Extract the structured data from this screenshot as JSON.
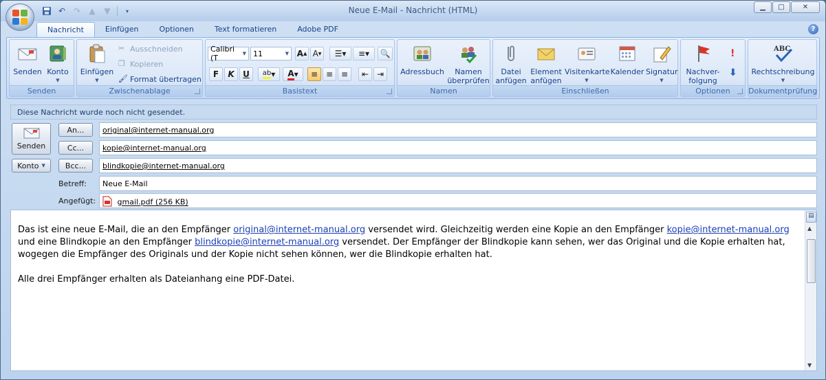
{
  "window": {
    "title": "Neue E-Mail - Nachricht (HTML)",
    "controls": {
      "minimize": "▁",
      "maximize": "□",
      "close": "✕"
    }
  },
  "qat": {
    "icons": [
      "save-icon",
      "undo-icon",
      "redo-icon",
      "up-arrow-icon",
      "down-arrow-icon",
      "customize-icon"
    ]
  },
  "tabs": [
    {
      "label": "Nachricht",
      "active": true
    },
    {
      "label": "Einfügen",
      "active": false
    },
    {
      "label": "Optionen",
      "active": false
    },
    {
      "label": "Text formatieren",
      "active": false
    },
    {
      "label": "Adobe PDF",
      "active": false
    }
  ],
  "help": "?",
  "ribbon": {
    "senden": {
      "label": "Senden",
      "btn_senden": "Senden",
      "btn_konto": "Konto"
    },
    "zwischenablage": {
      "label": "Zwischenablage",
      "btn_einfuegen": "Einfügen",
      "ausschneiden": "Ausschneiden",
      "kopieren": "Kopieren",
      "format": "Format übertragen"
    },
    "basistext": {
      "label": "Basistext",
      "font": "Calibri (T",
      "size": "11",
      "bold": "F",
      "italic": "K",
      "underline": "U"
    },
    "namen": {
      "label": "Namen",
      "adressbuch": "Adressbuch",
      "namen_line1": "Namen",
      "namen_line2": "überprüfen"
    },
    "einschliessen": {
      "label": "Einschließen",
      "datei_line1": "Datei",
      "datei_line2": "anfügen",
      "element_line1": "Element",
      "element_line2": "anfügen",
      "visitenkarte": "Visitenkarte",
      "kalender": "Kalender",
      "signatur": "Signatur"
    },
    "optionen": {
      "label": "Optionen",
      "nach_line1": "Nachver-",
      "nach_line2": "folgung"
    },
    "dokumentpruefung": {
      "label": "Dokumentprüfung",
      "rechtschreibung": "Rechtschreibung"
    }
  },
  "infobar": "Diese Nachricht wurde noch nicht gesendet.",
  "header": {
    "send_button": "Senden",
    "konto_button": "Konto",
    "an_button": "An...",
    "cc_button": "Cc...",
    "bcc_button": "Bcc...",
    "an_value": "original@internet-manual.org",
    "cc_value": "kopie@internet-manual.org",
    "bcc_value": "blindkopie@internet-manual.org",
    "betreff_label": "Betreff:",
    "betreff_value": "Neue E-Mail",
    "angefuegt_label": "Angefügt:",
    "attachment": "gmail.pdf (256 KB)"
  },
  "body": {
    "p1_a": "Das ist eine neue E-Mail, die an den Empfänger ",
    "p1_link1": "original@internet-manual.org",
    "p1_b": " versendet wird. Gleichzeitig werden eine Kopie an den Empfänger ",
    "p1_link2": "kopie@internet-manual.org",
    "p1_c": " und eine Blindkopie an den Empfänger ",
    "p1_link3": "blindkopie@internet-manual.org",
    "p1_d": " versendet. Der Empfänger der Blindkopie kann sehen, wer das Original und die Kopie erhalten hat, wogegen die Empfänger des Originals und der Kopie nicht sehen können, wer die Blindkopie erhalten hat.",
    "p2": "Alle drei Empfänger erhalten als Dateianhang eine PDF-Datei."
  },
  "colors": {
    "accent": "#15428b",
    "link": "#1a3fb5",
    "ribbon_bg": "#d5e4f7"
  }
}
